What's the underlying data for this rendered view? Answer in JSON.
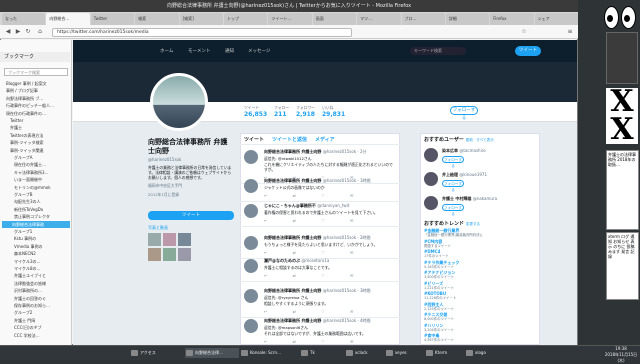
{
  "window_title": "向野総合法律事務所 弁護士向野(@harinez015sok)さん | Twitterからお気に入りツイート - Mozilla Firefox",
  "tabs": [
    "なった",
    "向野総合…",
    "Twitter",
    "検索",
    "[検索]",
    "トップ",
    "ツイート…",
    "画面",
    "マツ…",
    "ブロ…",
    "詳細",
    "Firefox",
    "シェア"
  ],
  "url": "https://twitter.com/harinez015sok/media",
  "sidebar": {
    "title": "ブックマーク",
    "search_placeholder": "ブックマーク検索",
    "items": [
      "Blogger 事例 / 起案文",
      "事例 / ブログ記事",
      "向野法律事務所 ブ…",
      "行政事件のピッチ一般人…",
      "現在住の行政事件の…",
      "Twitter",
      "弁護士",
      "Twitterの表現方法",
      "事例-ツイッタ検索",
      "事例-ツイッタ関連",
      "グループA",
      "現在住の弁護士…",
      "キャ法律事務所3…",
      "いま一面開催中",
      "モトリンの@mmok",
      "グループB",
      "勾配先生3の人",
      "新住所ToVegDo",
      "禁止事例コブレクタ",
      "向野総合法律事務",
      "グループ1",
      "Kstu 事例の",
      "Vmedia 事例の",
      "森本NECN2",
      "マイケル3の…",
      "マイケル8の…",
      "弁護士ユイブイと",
      "法律勉強会の皆様",
      "沢村事務所の…",
      "弁護士の回答のぐ",
      "保存事例のお知ら…",
      "グループ2",
      "弁護士 門岡",
      "CCC(日)のギブ",
      "CCC 学校法…"
    ]
  },
  "twitter": {
    "nav": [
      "ホーム",
      "モーメント",
      "通知",
      "メッセージ"
    ],
    "search_placeholder": "キーワード検索",
    "tweet_button": "ツイート"
  },
  "profile": {
    "name": "向野総合法律事務所 弁護士向野",
    "handle": "@harinez015sok",
    "bio": "弁護士の業務と法律事務所の日常を発信しています。法律相談・講演のご依頼はウェブサイトからお願いします。個人の感想です。",
    "location": "福岡市中央区大手門",
    "joined": "2012年1月に登録",
    "tweet_button": "ツイート",
    "photos_label": "写真と動画"
  },
  "stats": [
    {
      "label": "ツイート",
      "value": "26,853"
    },
    {
      "label": "フォロー",
      "value": "211"
    },
    {
      "label": "フォロワー",
      "value": "2,918"
    },
    {
      "label": "いいね",
      "value": "29,831"
    }
  ],
  "follow_button": "フォローする",
  "timeline_tabs": [
    "ツイート",
    "ツイートと返信",
    "メディア"
  ],
  "tweets": [
    {
      "name": "向野総合法律事務所 弁護士向野",
      "meta": "@harinez015sok · 2分",
      "reply": "返信先: @ntwaki1012さん",
      "body": "これを機にクリエイティブの人たちに対する報酬が適正化されるといいのですが。"
    },
    {
      "name": "向野総合法律事務所 弁護士向野",
      "meta": "@harinez015sok · 1時間",
      "reply": "",
      "body": "ジャケット公式の画像ではないのか"
    },
    {
      "name": "じゃにこ・ちゃん@事務所不",
      "meta": "@danniyan_twit",
      "reply": "",
      "body": "著作権の侵害と思われるので弁護士さんのツイートを見て下さい。"
    },
    {
      "name": "向野総合法律事務所 弁護士向野",
      "meta": "@harinez015sok · 2時間",
      "reply": "",
      "body": "もうちょっと様子を見たらよいと思いますけど、いかがでしょう。"
    },
    {
      "name": "瀬戸@なのためのぶ",
      "meta": "@mosetoro1a",
      "reply": "",
      "body": "弁護士に相談するのは大事なことです。"
    },
    {
      "name": "向野総合法律事務所 弁護士向野",
      "meta": "@harinez015sok · 3時間",
      "reply": "返信先: @ryeyreixa さん",
      "body": "相談しやすくするように頑張ります。"
    },
    {
      "name": "向野総合法律事務所 弁護士向野",
      "meta": "@harinez015sok · 4時間",
      "reply": "返信先: @mapsonl6さん",
      "body": "それは全部ではないですが、弁護士の業務範囲は広いです。"
    }
  ],
  "tweet_actions": "↩ ⇄ ♡ ✉",
  "suggest": {
    "title": "おすすめユーザー",
    "links": "更新 · すべて表示",
    "users": [
      {
        "name": "染本広幸",
        "handle": "@tacmashiro",
        "btn": "フォローする"
      },
      {
        "name": "井上絵理",
        "handle": "@kinoue1971",
        "btn": "フォローする"
      },
      {
        "name": "弁護士 中村輝雄",
        "handle": "@nakamura",
        "btn": "フォローする"
      }
    ]
  },
  "trends": {
    "title": "おすすめトレンド",
    "link": "変更する",
    "items": [
      {
        "t": "#金融総一銀行業界",
        "s": "「金融総一銀行業界(最高裁判所判決)」"
      },
      {
        "t": "#CM内容",
        "s": "関連するツイート"
      },
      {
        "t": "#DMC4",
        "s": "17件のツイート"
      },
      {
        "t": "#テラ作業チェック",
        "s": "5,163件のツイート"
      },
      {
        "t": "#アテナビジョン",
        "s": "3,400件のツイート"
      },
      {
        "t": "#ビリーズ",
        "s": "1,221件のツイート"
      },
      {
        "t": "#KOTOBU",
        "s": "11,226件のツイート"
      },
      {
        "t": "#西野主人",
        "s": "2,125件のツイート"
      },
      {
        "t": "#テニス交差",
        "s": "8,000件のツイート"
      },
      {
        "t": "#ハリリン",
        "s": "3,204件のツイート"
      },
      {
        "t": "#食中毒",
        "s": "4,567件のツイート"
      }
    ]
  },
  "taskbar": {
    "items": [
      "アクセス",
      "向野総合法律…",
      "Konsole: Scrn…",
      "Tk",
      "xclock",
      "xeyes",
      "Kterm",
      "xlogo"
    ],
    "time": "19:38",
    "date": "2018年11月15日(木)"
  },
  "right_panel": {
    "term1": "弁護士の法律事務所 2018年の取扱…",
    "term2": "xterm ログ 通知 お知らせ 表示 のちに 投稿 みます 発言 記録"
  }
}
